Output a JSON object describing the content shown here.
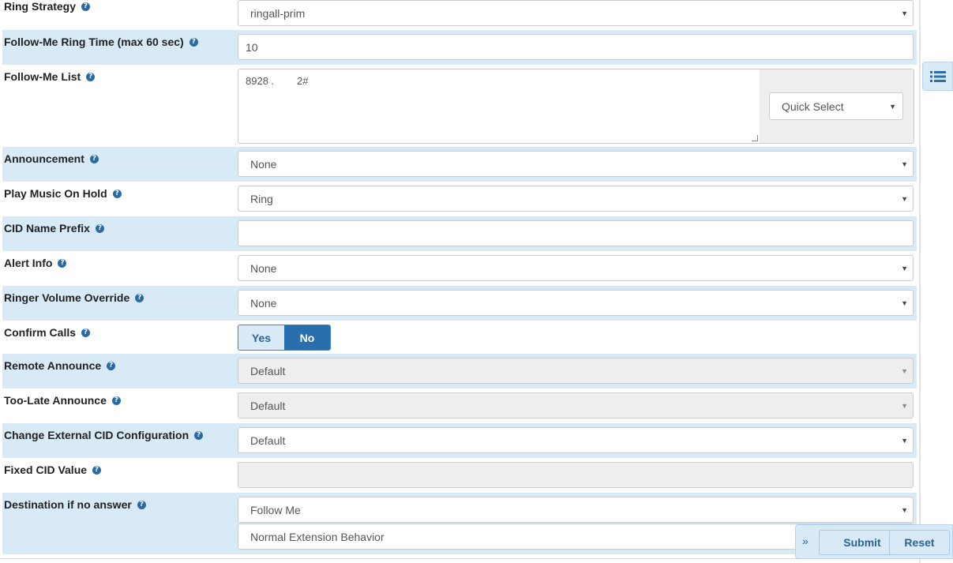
{
  "form": {
    "ring_strategy": {
      "label": "Ring Strategy",
      "value": "ringall-prim"
    },
    "ring_time": {
      "label": "Follow-Me Ring Time (max 60 sec)",
      "value": "10"
    },
    "followme_list": {
      "label": "Follow-Me List",
      "value": "8928 .        2#",
      "quick_select": "Quick Select"
    },
    "announcement": {
      "label": "Announcement",
      "value": "None"
    },
    "moh": {
      "label": "Play Music On Hold",
      "value": "Ring"
    },
    "cid_prefix": {
      "label": "CID Name Prefix",
      "value": ""
    },
    "alert_info": {
      "label": "Alert Info",
      "value": "None"
    },
    "ringer_volume": {
      "label": "Ringer Volume Override",
      "value": "None"
    },
    "confirm_calls": {
      "label": "Confirm Calls",
      "yes": "Yes",
      "no": "No",
      "selected": "No"
    },
    "remote_announce": {
      "label": "Remote Announce",
      "value": "Default"
    },
    "too_late": {
      "label": "Too-Late Announce",
      "value": "Default"
    },
    "ext_cid": {
      "label": "Change External CID Configuration",
      "value": "Default"
    },
    "fixed_cid": {
      "label": "Fixed CID Value",
      "value": ""
    },
    "destination": {
      "label": "Destination if no answer",
      "value": "Follow Me",
      "value2": "Normal Extension Behavior"
    }
  },
  "footer": {
    "submit": "Submit",
    "reset": "Reset"
  },
  "icons": {
    "help": "question-circle-icon",
    "caret": "caret-down-icon",
    "list": "list-icon",
    "chevron": "double-chevron-right-icon"
  },
  "colors": {
    "row_alt": "#d9eaf7",
    "accent": "#2a6fad",
    "help": "#2b6ba5"
  }
}
